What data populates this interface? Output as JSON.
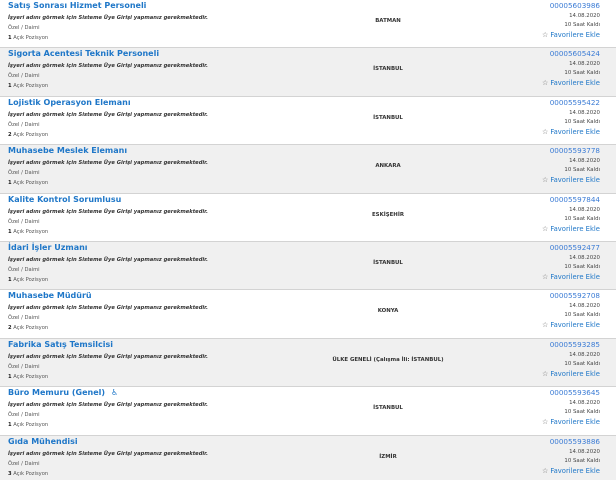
{
  "common": {
    "desc": "İşyeri adını görmek için Sisteme Üye Girişi yapmanız gerekmektedir.",
    "type": "Özel / Daimi",
    "positions_suffix": "Açık Pozisyon",
    "fav_label": "Favorilere Ekle",
    "remaining": "10 Saat Kaldı"
  },
  "jobs": [
    {
      "title": "Satış Sonrası Hizmet Personeli",
      "city": "BATMAN",
      "code": "00005603986",
      "date": "14.08.2020",
      "positions": "1",
      "icon": ""
    },
    {
      "title": "Sigorta Acentesi Teknik Personeli",
      "city": "İSTANBUL",
      "code": "00005605424",
      "date": "14.08.2020",
      "positions": "1",
      "icon": ""
    },
    {
      "title": "Lojistik Operasyon Elemanı",
      "city": "İSTANBUL",
      "code": "00005595422",
      "date": "14.08.2020",
      "positions": "2",
      "icon": ""
    },
    {
      "title": "Muhasebe Meslek Elemanı",
      "city": "ANKARA",
      "code": "00005593778",
      "date": "14.08.2020",
      "positions": "1",
      "icon": ""
    },
    {
      "title": "Kalite Kontrol Sorumlusu",
      "city": "ESKİŞEHİR",
      "code": "00005597844",
      "date": "14.08.2020",
      "positions": "1",
      "icon": ""
    },
    {
      "title": "İdari İşler Uzmanı",
      "city": "İSTANBUL",
      "code": "00005592477",
      "date": "14.08.2020",
      "positions": "1",
      "icon": ""
    },
    {
      "title": "Muhasebe Müdürü",
      "city": "KONYA",
      "code": "00005592708",
      "date": "14.08.2020",
      "positions": "2",
      "icon": ""
    },
    {
      "title": "Fabrika Satış Temsilcisi",
      "city": "ÜLKE GENELİ (Çalışma İli: İSTANBUL)",
      "code": "00005593285",
      "date": "14.08.2020",
      "positions": "1",
      "icon": ""
    },
    {
      "title": "Büro Memuru (Genel)",
      "city": "İSTANBUL",
      "code": "00005593645",
      "date": "14.08.2020",
      "positions": "1",
      "icon": "♿"
    },
    {
      "title": "Gıda Mühendisi",
      "city": "İZMİR",
      "code": "00005593886",
      "date": "14.08.2020",
      "positions": "3",
      "icon": ""
    }
  ]
}
